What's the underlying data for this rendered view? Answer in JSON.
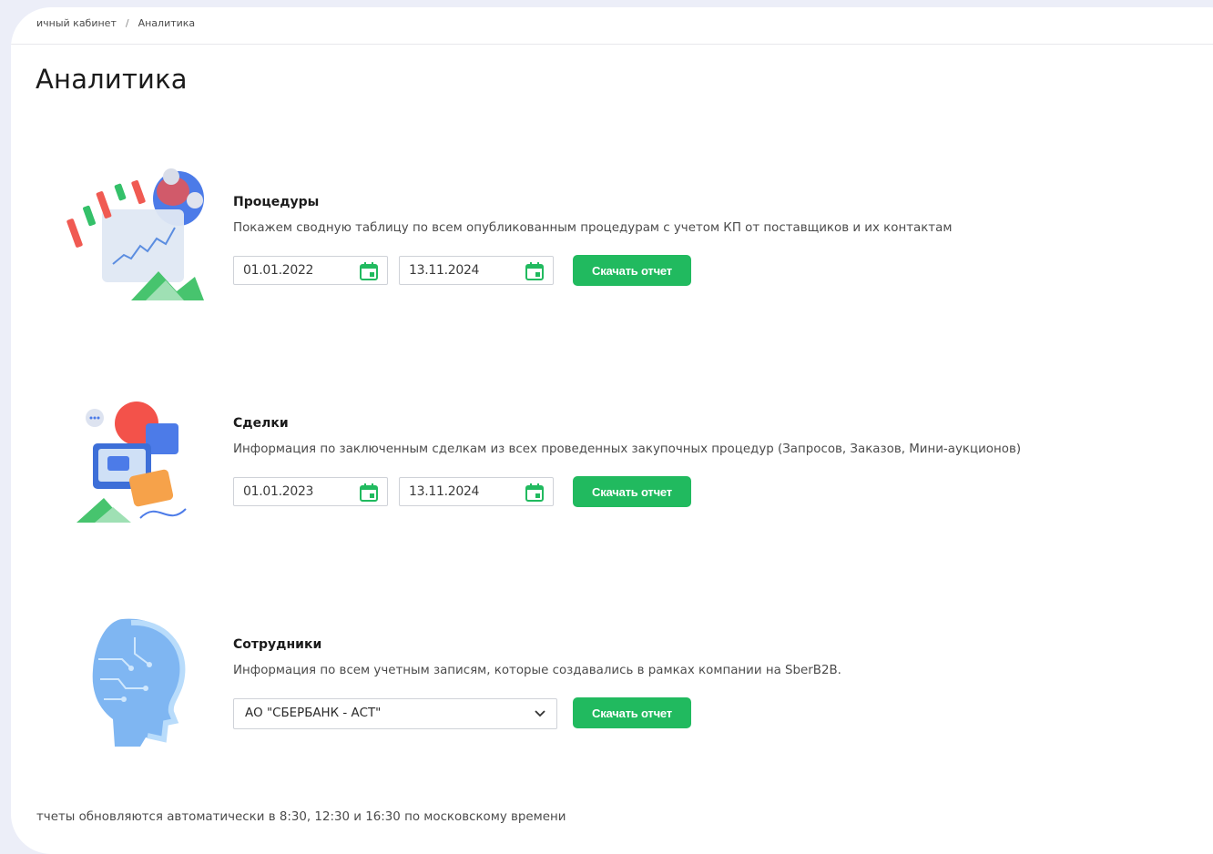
{
  "breadcrumb": {
    "items": [
      "ичный кабинет",
      "Аналитика"
    ],
    "separator": "/"
  },
  "page": {
    "title": "Аналитика"
  },
  "sections": [
    {
      "title": "Процедуры",
      "description": "Покажем сводную таблицу по всем опубликованным процедурам с учетом КП от поставщиков и их контактам",
      "date_from": "01.01.2022",
      "date_to": "13.11.2024",
      "button_label": "Скачать отчет"
    },
    {
      "title": "Сделки",
      "description": "Информация по заключенным сделкам из всех проведенных закупочных процедур (Запросов, Заказов, Мини-аукционов)",
      "date_from": "01.01.2023",
      "date_to": "13.11.2024",
      "button_label": "Скачать отчет"
    },
    {
      "title": "Сотрудники",
      "description": "Информация по всем учетным записям, которые создавались в рамках компании на SberB2B.",
      "company_select": "АО \"СБЕРБАНК - АСТ\"",
      "button_label": "Скачать отчет"
    }
  ],
  "footer": {
    "note": "тчеты обновляются автоматически в 8:30, 12:30 и 16:30 по московскому времени"
  },
  "colors": {
    "accent": "#21ba5f",
    "background": "#eceef8",
    "card": "#ffffff"
  },
  "icons": {
    "calendar": "calendar-icon",
    "chevron": "chevron-down-icon"
  }
}
